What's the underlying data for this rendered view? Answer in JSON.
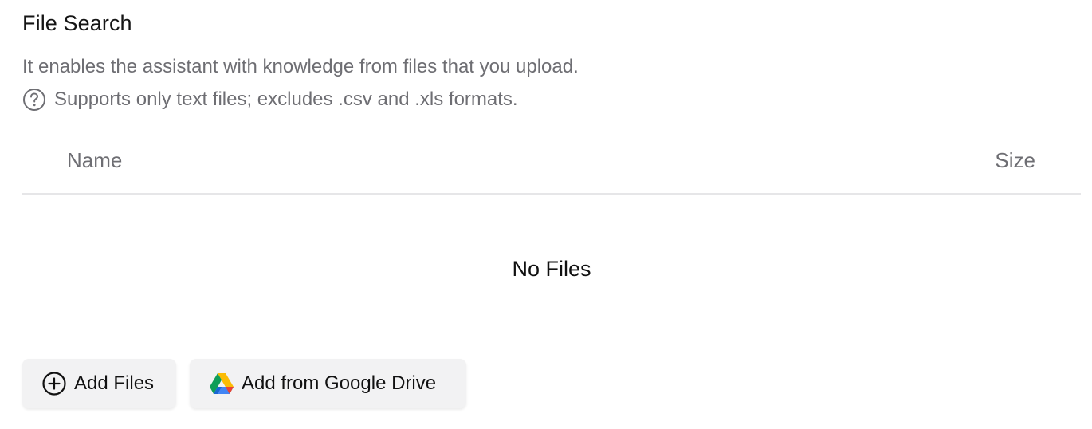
{
  "section": {
    "title": "File Search",
    "description": "It enables the assistant with knowledge from files that you upload.",
    "note": "Supports only text files; excludes .csv and .xls formats.",
    "note_icon": "help-circle-icon"
  },
  "table": {
    "columns": [
      "Name",
      "Size"
    ],
    "rows": [],
    "empty_text": "No Files"
  },
  "actions": {
    "add_files_label": "Add Files",
    "add_files_icon": "plus-circle-icon",
    "add_drive_label": "Add from Google Drive",
    "add_drive_icon": "google-drive-icon"
  },
  "colors": {
    "text_primary": "#111111",
    "text_secondary": "#6e6e73",
    "button_bg": "#f2f2f3",
    "divider": "#e6e6e8"
  }
}
